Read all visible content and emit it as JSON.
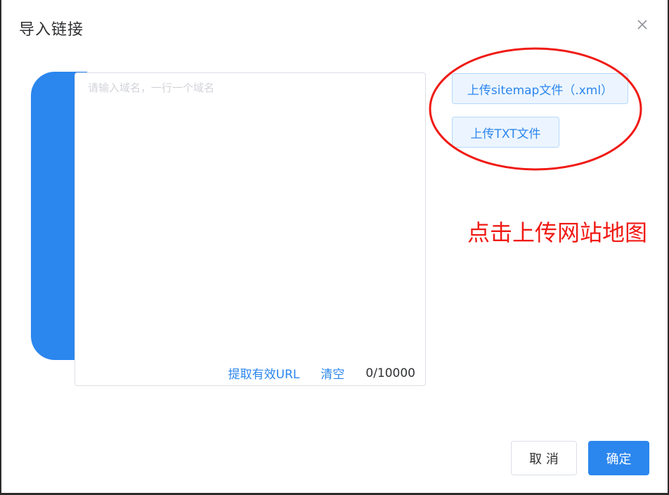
{
  "dialog": {
    "title": "导入链接",
    "close_icon": "close-icon"
  },
  "editor": {
    "placeholder": "请输入域名，一行一个域名",
    "value": "",
    "extract_label": "提取有效URL",
    "clear_label": "清空",
    "counter": "0/10000"
  },
  "upload": {
    "sitemap_label": "上传sitemap文件（.xml）",
    "txt_label": "上传TXT文件"
  },
  "annotation": {
    "text": "点击上传网站地图",
    "color": "#f01a14"
  },
  "footer": {
    "cancel_label": "取 消",
    "confirm_label": "确定"
  },
  "colors": {
    "primary": "#2b86ee",
    "primary_light_bg": "#ecf5ff",
    "border": "#dcdfe6",
    "text": "#303133"
  }
}
